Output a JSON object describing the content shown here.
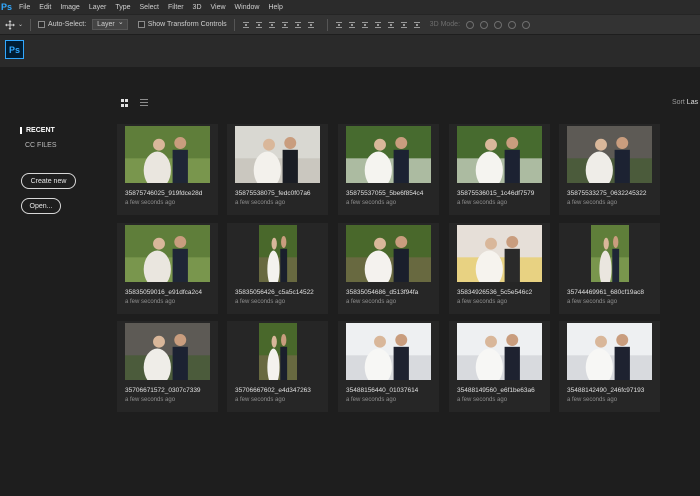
{
  "menu": {
    "app_glyph": "Ps",
    "items": [
      "File",
      "Edit",
      "Image",
      "Layer",
      "Type",
      "Select",
      "Filter",
      "3D",
      "View",
      "Window",
      "Help"
    ]
  },
  "options": {
    "auto_select_label": "Auto-Select:",
    "auto_select_value": "Layer",
    "show_transform_label": "Show Transform Controls",
    "mode_3d_label": "3D Mode:"
  },
  "logo": {
    "text": "Ps",
    "color": "#31a8ff"
  },
  "sidebar": {
    "recent_label": "RECENT",
    "cc_files_label": "CC FILES",
    "create_new_label": "Create new",
    "open_label": "Open..."
  },
  "sort": {
    "label": "Sort",
    "value": "Las"
  },
  "files": [
    {
      "name": "35875746025_919fdce28d",
      "time": "a few seconds ago",
      "scene": "green"
    },
    {
      "name": "35875538075_fedc0f07a6",
      "time": "a few seconds ago",
      "scene": "white"
    },
    {
      "name": "35875537055_5be6f854c4",
      "time": "a few seconds ago",
      "scene": "arch"
    },
    {
      "name": "35875536015_1c46df7579",
      "time": "a few seconds ago",
      "scene": "arch"
    },
    {
      "name": "35875533275_0632245322",
      "time": "a few seconds ago",
      "scene": "stone"
    },
    {
      "name": "35835059016_e91dfca2c4",
      "time": "a few seconds ago",
      "scene": "green"
    },
    {
      "name": "35835056426_c5a5c14522",
      "time": "a few seconds ago",
      "scene": "garden"
    },
    {
      "name": "35835054686_d513f94fa",
      "time": "a few seconds ago",
      "scene": "garden"
    },
    {
      "name": "35834926536_5c5e546c2",
      "time": "a few seconds ago",
      "scene": "interior"
    },
    {
      "name": "35744469961_680cf19ac8",
      "time": "a few seconds ago",
      "scene": "green"
    },
    {
      "name": "35706671572_0307c7339",
      "time": "a few seconds ago",
      "scene": "stone"
    },
    {
      "name": "35706667602_e4d347263",
      "time": "a few seconds ago",
      "scene": "garden"
    },
    {
      "name": "35488156440_01037614",
      "time": "a few seconds ago",
      "scene": "reception"
    },
    {
      "name": "35488149560_e6f1be63a6",
      "time": "a few seconds ago",
      "scene": "reception"
    },
    {
      "name": "35488142490_246fc97193",
      "time": "a few seconds ago",
      "scene": "reception"
    }
  ]
}
